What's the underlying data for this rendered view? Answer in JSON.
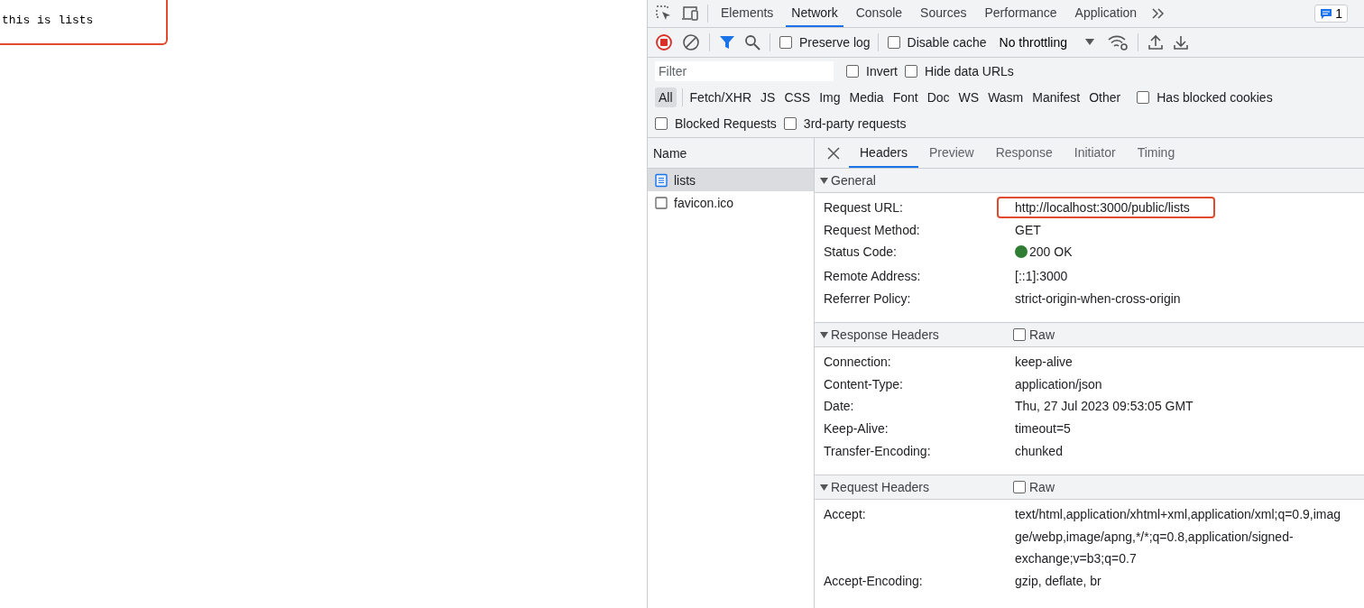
{
  "page": {
    "text": "this is lists",
    "highlighted": true
  },
  "devtools": {
    "tabs": [
      {
        "label": "Elements",
        "selected": false
      },
      {
        "label": "Network",
        "selected": true
      },
      {
        "label": "Console",
        "selected": false
      },
      {
        "label": "Sources",
        "selected": false
      },
      {
        "label": "Performance",
        "selected": false
      },
      {
        "label": "Application",
        "selected": false
      }
    ],
    "issues_badge": "1",
    "toolbar": {
      "recording": true,
      "checkboxes": [
        {
          "label": "Preserve log",
          "checked": false
        },
        {
          "label": "Disable cache",
          "checked": false
        }
      ],
      "throttling": "No throttling"
    },
    "filter": {
      "placeholder": "Filter",
      "options": [
        {
          "label": "Invert",
          "checked": false
        },
        {
          "label": "Hide data URLs",
          "checked": false
        }
      ]
    },
    "type_filters": [
      {
        "label": "All",
        "selected": true
      },
      {
        "label": "Fetch/XHR",
        "selected": false
      },
      {
        "label": "JS",
        "selected": false
      },
      {
        "label": "CSS",
        "selected": false
      },
      {
        "label": "Img",
        "selected": false
      },
      {
        "label": "Media",
        "selected": false
      },
      {
        "label": "Font",
        "selected": false
      },
      {
        "label": "Doc",
        "selected": false
      },
      {
        "label": "WS",
        "selected": false
      },
      {
        "label": "Wasm",
        "selected": false
      },
      {
        "label": "Manifest",
        "selected": false
      },
      {
        "label": "Other",
        "selected": false
      }
    ],
    "has_blocked_cookies": {
      "label": "Has blocked cookies",
      "checked": false
    },
    "extra_filters": [
      {
        "label": "Blocked Requests",
        "checked": false
      },
      {
        "label": "3rd-party requests",
        "checked": false
      }
    ],
    "requests": {
      "column": "Name",
      "rows": [
        {
          "name": "lists",
          "kind": "document",
          "selected": true
        },
        {
          "name": "favicon.ico",
          "kind": "other",
          "selected": false
        }
      ]
    },
    "detail_tabs": [
      {
        "label": "Headers",
        "selected": true
      },
      {
        "label": "Preview",
        "selected": false
      },
      {
        "label": "Response",
        "selected": false
      },
      {
        "label": "Initiator",
        "selected": false
      },
      {
        "label": "Timing",
        "selected": false
      }
    ],
    "sections": [
      {
        "title": "General",
        "expanded": true,
        "rows": [
          {
            "key": "Request URL:",
            "value": "http://localhost:3000/public/lists",
            "highlighted": true
          },
          {
            "key": "Request Method:",
            "value": "GET"
          },
          {
            "key": "Status Code:",
            "value": "200 OK",
            "color": "#2e7d32"
          },
          {
            "key": "Remote Address:",
            "value": "[::1]:3000"
          },
          {
            "key": "Referrer Policy:",
            "value": "strict-origin-when-cross-origin"
          }
        ]
      },
      {
        "title": "Response Headers",
        "expanded": true,
        "raw": {
          "label": "Raw",
          "checked": false
        },
        "rows": [
          {
            "key": "Connection:",
            "value": "keep-alive"
          },
          {
            "key": "Content-Type:",
            "value": "application/json"
          },
          {
            "key": "Date:",
            "value": "Thu, 27 Jul 2023 09:53:05 GMT"
          },
          {
            "key": "Keep-Alive:",
            "value": "timeout=5"
          },
          {
            "key": "Transfer-Encoding:",
            "value": "chunked"
          }
        ]
      },
      {
        "title": "Request Headers",
        "expanded": true,
        "raw": {
          "label": "Raw",
          "checked": false
        },
        "rows": [
          {
            "key": "Accept:",
            "lines": [
              "text/html,application/xhtml+xml,application/xml;q=0.9,imag",
              "ge/webp,image/apng,*/*;q=0.8,application/signed-",
              "exchange;v=b3;q=0.7"
            ]
          },
          {
            "key": "Accept-Encoding:",
            "value": "gzip, deflate, br"
          }
        ]
      }
    ]
  }
}
